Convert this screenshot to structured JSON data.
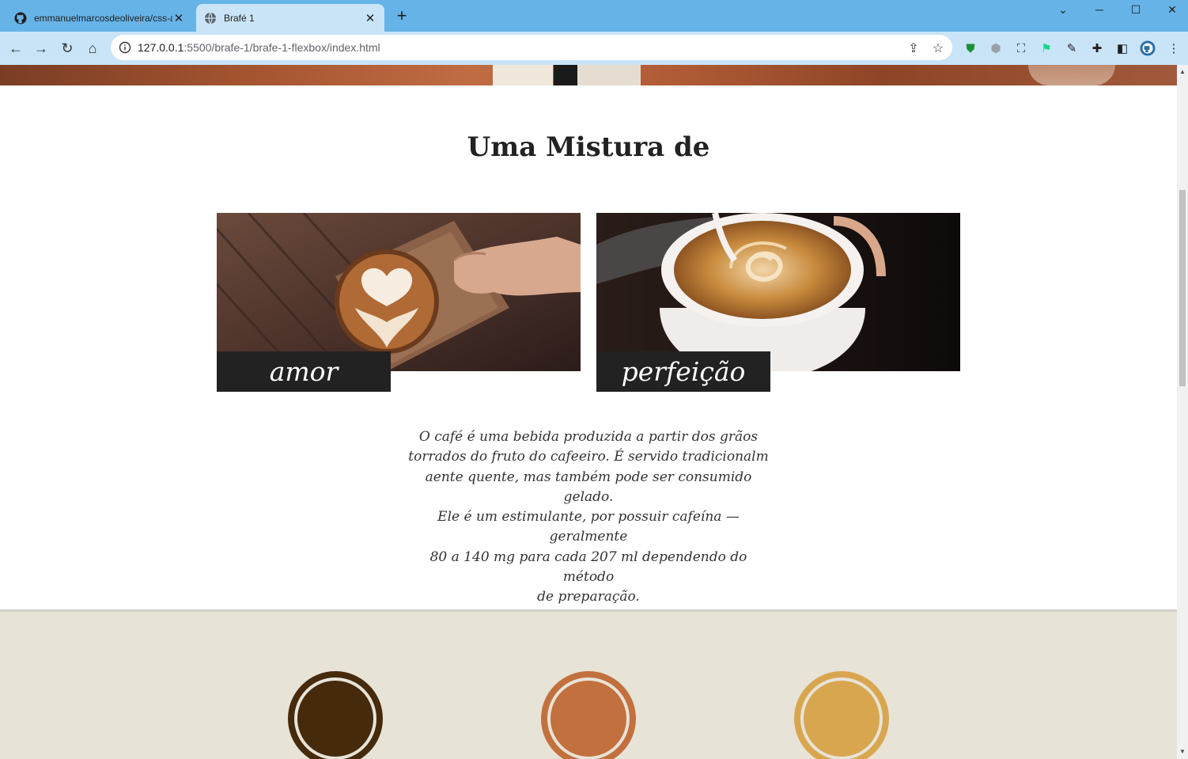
{
  "browser": {
    "tabs": [
      {
        "title": "emmanuelmarcosdeoliveira/css-alura",
        "active": false,
        "icon": "github-icon"
      },
      {
        "title": "Brafé 1",
        "active": true,
        "icon": "globe-icon"
      }
    ],
    "new_tab_label": "+",
    "url_host": "127.0.0.1",
    "url_rest": ":5500/brafe-1/brafe-1-flexbox/index.html",
    "accent_color": "#66b3e8"
  },
  "page": {
    "section_title": "Uma Mistura de",
    "cards": [
      {
        "caption": "amor"
      },
      {
        "caption": "perfeição"
      }
    ],
    "description": "O café é uma bebida produzida a partir dos grãos torrados do fruto do cafeeiro. É servido tradicionalm aente quente, mas também pode ser consumido gelado. Ele é um estimulante, por possuir cafeína — geralmente 80 a 140 mg para cada 207 ml dependendo do método de preparação.",
    "description_lines": [
      "O café é uma bebida produzida a partir dos grãos",
      "torrados do fruto do cafeeiro. É servido tradicionalm",
      "aente quente, mas também pode ser consumido gelado.",
      "Ele é um estimulante, por possuir cafeína — geralmente",
      "80 a 140 mg para cada 207 ml dependendo do método",
      "de preparação."
    ],
    "blend_colors": [
      "#462a0c",
      "#c2703d",
      "#d9a650"
    ]
  }
}
